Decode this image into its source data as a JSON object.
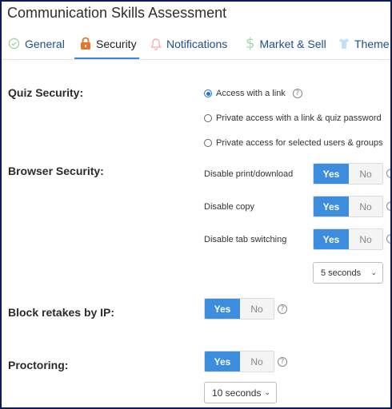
{
  "page": {
    "title": "Communication Skills Assessment"
  },
  "tabs": [
    {
      "label": "General",
      "icon": "check-circle-icon",
      "active": false
    },
    {
      "label": "Security",
      "icon": "lock-icon",
      "active": true
    },
    {
      "label": "Notifications",
      "icon": "bell-icon",
      "active": false
    },
    {
      "label": "Market & Sell",
      "icon": "dollar-icon",
      "active": false
    },
    {
      "label": "Theme",
      "icon": "shirt-icon",
      "active": false
    }
  ],
  "quiz_security": {
    "label": "Quiz Security:",
    "options": [
      {
        "label": "Access with a link",
        "checked": true
      },
      {
        "label": "Private access with a link & quiz password",
        "checked": false
      },
      {
        "label": "Private access for selected users & groups",
        "checked": false
      }
    ]
  },
  "browser_security": {
    "label": "Browser Security:",
    "settings": [
      {
        "label": "Disable print/download",
        "yes": "Yes",
        "no": "No",
        "value": "Yes"
      },
      {
        "label": "Disable copy",
        "yes": "Yes",
        "no": "No",
        "value": "Yes"
      },
      {
        "label": "Disable tab switching",
        "yes": "Yes",
        "no": "No",
        "value": "Yes"
      }
    ],
    "tab_switch_delay": "5 seconds"
  },
  "block_retakes": {
    "label": "Block retakes by IP:",
    "yes": "Yes",
    "no": "No",
    "value": "Yes"
  },
  "proctoring": {
    "label": "Proctoring:",
    "yes": "Yes",
    "no": "No",
    "value": "Yes",
    "interval": "10 seconds"
  },
  "colors": {
    "accent": "#3c8dde",
    "tab_text": "#1f4e8c",
    "frame": "#0a1a5c"
  }
}
